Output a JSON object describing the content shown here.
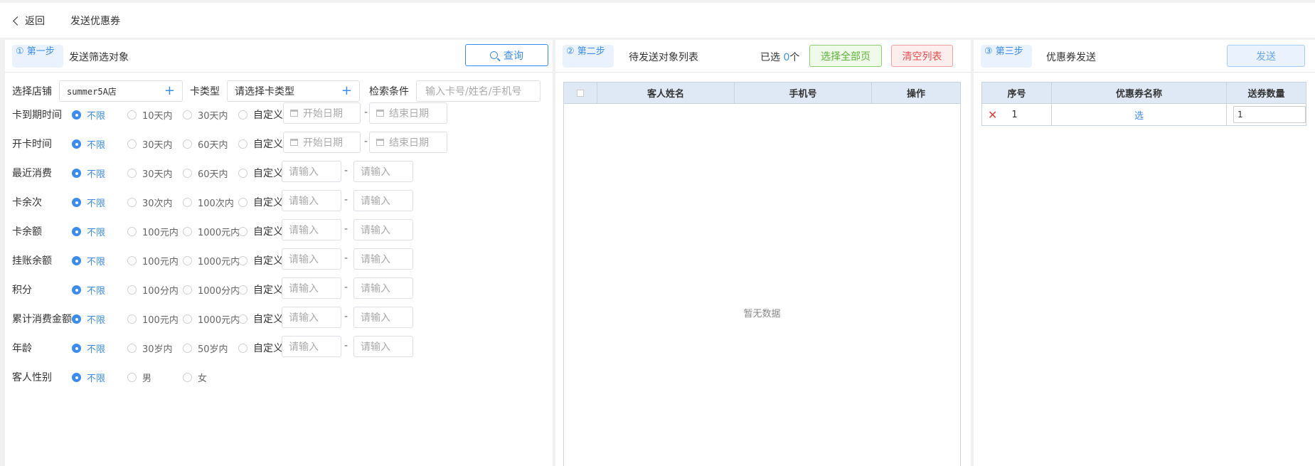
{
  "header": {
    "back_label": "返回",
    "title": "发送优惠券"
  },
  "step1": {
    "badge": "① 第一步",
    "title": "发送筛选对象",
    "query_label": "查询",
    "store_label": "选择店铺",
    "store_value": "summer5A店",
    "cardtype_label": "卡类型",
    "cardtype_value": "请选择卡类型",
    "search_label": "检索条件",
    "search_placeholder": "输入卡号/姓名/手机号",
    "custom_label": "自定义",
    "start_date": "开始日期",
    "end_date": "结束日期",
    "input_placeholder": "请输入",
    "rows": [
      {
        "label": "卡到期时间",
        "opts": [
          "不限",
          "10天内",
          "30天内"
        ]
      },
      {
        "label": "开卡时间",
        "opts": [
          "不限",
          "30天内",
          "60天内"
        ]
      },
      {
        "label": "最近消费",
        "opts": [
          "不限",
          "30天内",
          "60天内"
        ]
      },
      {
        "label": "卡余次",
        "opts": [
          "不限",
          "30次内",
          "100次内"
        ]
      },
      {
        "label": "卡余额",
        "opts": [
          "不限",
          "100元内",
          "1000元内"
        ]
      },
      {
        "label": "挂账余额",
        "opts": [
          "不限",
          "100元内",
          "1000元内"
        ]
      },
      {
        "label": "积分",
        "opts": [
          "不限",
          "100分内",
          "1000分内"
        ]
      },
      {
        "label": "累计消费金额",
        "opts": [
          "不限",
          "100元内",
          "1000元内"
        ]
      },
      {
        "label": "年龄",
        "opts": [
          "不限",
          "30岁内",
          "50岁内"
        ]
      },
      {
        "label": "客人性别",
        "opts": [
          "不限",
          "男",
          "女"
        ]
      }
    ]
  },
  "step2": {
    "badge": "② 第二步",
    "title": "待发送对象列表",
    "selected_prefix": "已选",
    "selected_count": "0",
    "selected_suffix": "个",
    "select_all_label": "选择全部页",
    "clear_label": "清空列表",
    "columns": [
      "客人姓名",
      "手机号",
      "操作"
    ],
    "empty_text": "暂无数据"
  },
  "step3": {
    "badge": "③ 第三步",
    "title": "优惠券发送",
    "send_label": "发送",
    "columns": [
      "序号",
      "优惠券名称",
      "送券数量"
    ],
    "rows": [
      {
        "index": "1",
        "name": "选",
        "qty": "1"
      }
    ]
  },
  "colors": {
    "accent": "#3b8cf0",
    "success": "#5ab434",
    "danger": "#e85050"
  }
}
